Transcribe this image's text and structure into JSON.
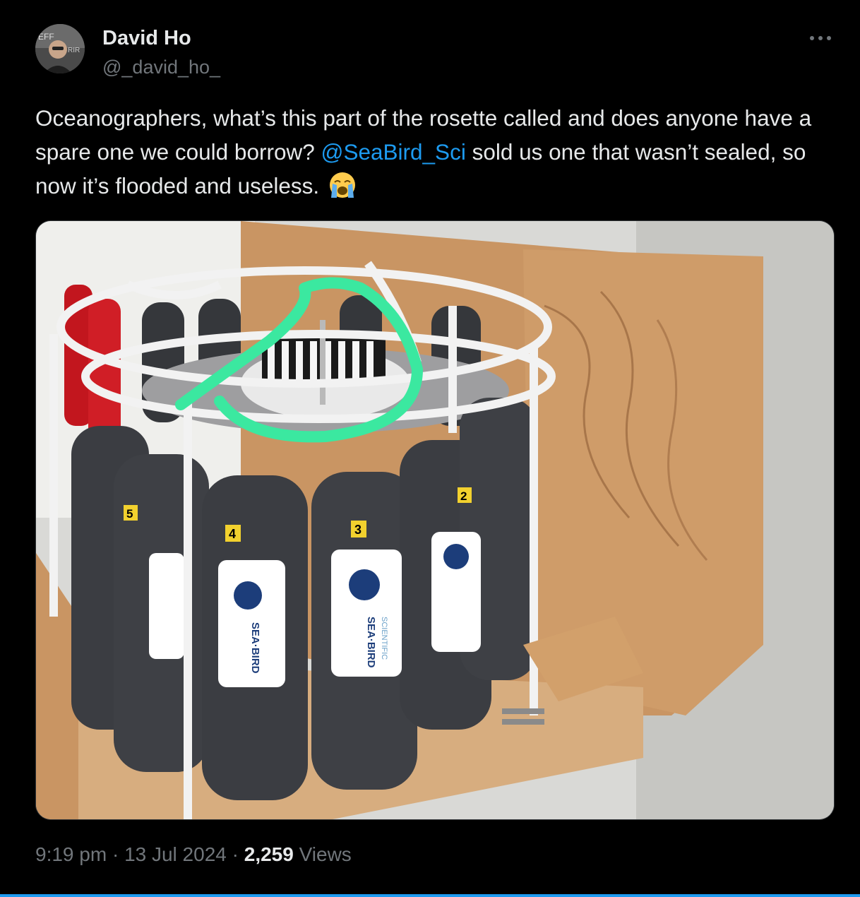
{
  "author": {
    "name": "David Ho",
    "handle": "@_david_ho_"
  },
  "tweet": {
    "text_before": "Oceanographers, what’s this part of the rosette called and does anyone have a spare one we could borrow? ",
    "mention": "@SeaBird_Sci",
    "text_after": " sold us one that wasn’t sealed, so now it’s flooded and useless."
  },
  "photo": {
    "bottle_numbers": [
      "5",
      "4",
      "3",
      "2"
    ],
    "brand_line1": "SEA·BIRD",
    "brand_line2": "SCIENTIFIC",
    "colors": {
      "frame": "#f2f2f2",
      "bottle": "#3b3d42",
      "crate": "#c9935e",
      "highlight": "#3be8a0"
    }
  },
  "meta": {
    "time": "9:19 pm",
    "date": "13 Jul 2024",
    "sep": " · ",
    "views_count": "2,259",
    "views_label": " Views"
  },
  "icons": {
    "more": "more-dots-icon",
    "emoji": "crying-face-icon"
  }
}
